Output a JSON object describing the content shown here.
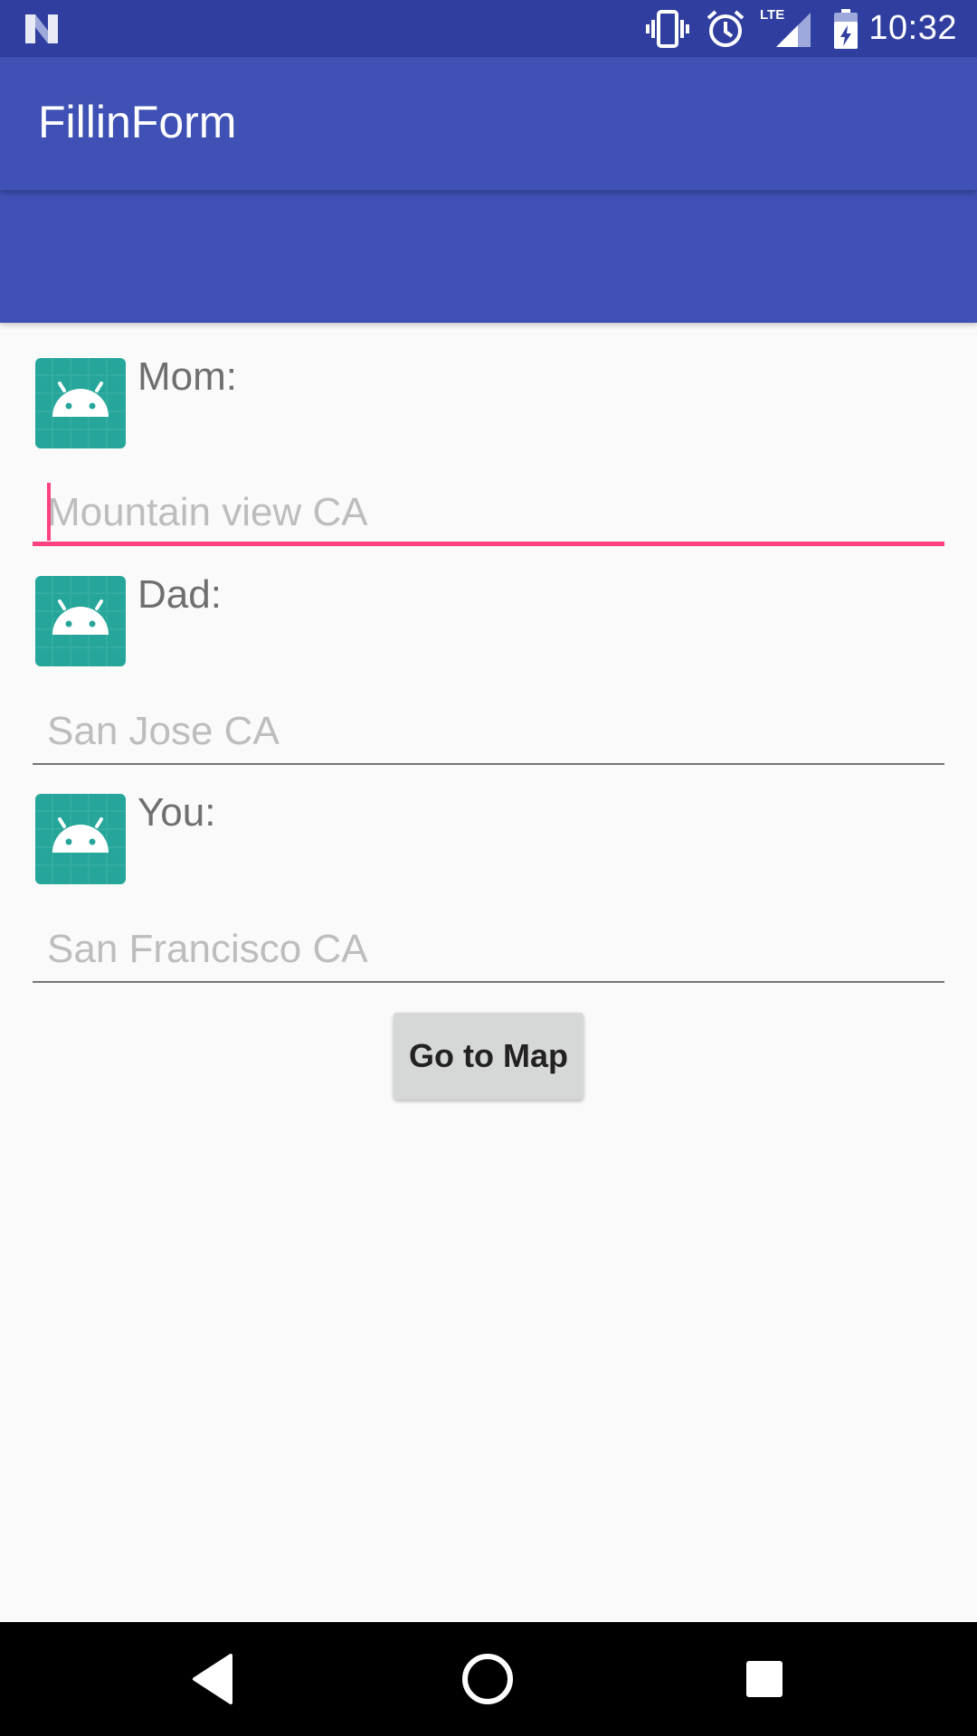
{
  "status_bar": {
    "time": "10:32",
    "network_label": "LTE",
    "icons": [
      "android-n-icon",
      "vibrate-icon",
      "alarm-icon",
      "signal-icon",
      "battery-charging-icon"
    ]
  },
  "app_bar": {
    "title": "FillinForm"
  },
  "form": {
    "rows": [
      {
        "label": "Mom:",
        "placeholder": "Mountain view CA",
        "icon": "android-launcher-icon",
        "focused": true
      },
      {
        "label": "Dad:",
        "placeholder": "San Jose CA",
        "icon": "android-launcher-icon",
        "focused": false
      },
      {
        "label": "You:",
        "placeholder": "San Francisco CA",
        "icon": "android-launcher-icon",
        "focused": false
      }
    ],
    "button_label": "Go to Map"
  },
  "nav_bar": {
    "icons": [
      "back-icon",
      "home-icon",
      "recents-icon"
    ]
  },
  "colors": {
    "status_bar": "#303f9f",
    "primary": "#3f51b5",
    "accent": "#ff4081",
    "icon_teal": "#26a69a"
  }
}
